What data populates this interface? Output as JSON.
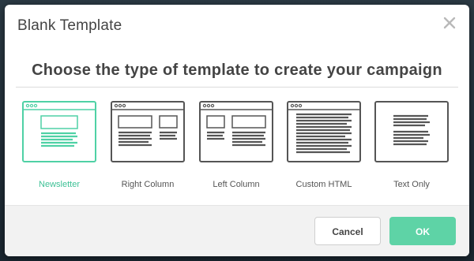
{
  "dialog": {
    "title": "Blank Template",
    "prompt": "Choose the type of template to create your campaign"
  },
  "templates": [
    {
      "label": "Newsletter",
      "selected": true
    },
    {
      "label": "Right Column",
      "selected": false
    },
    {
      "label": "Left Column",
      "selected": false
    },
    {
      "label": "Custom HTML",
      "selected": false
    },
    {
      "label": "Text Only",
      "selected": false
    }
  ],
  "footer": {
    "cancel_label": "Cancel",
    "ok_label": "OK"
  },
  "colors": {
    "accent": "#4fd1a5",
    "ok_button": "#5ed3a6",
    "outline": "#555555"
  },
  "icons": {
    "close": "close-icon"
  }
}
